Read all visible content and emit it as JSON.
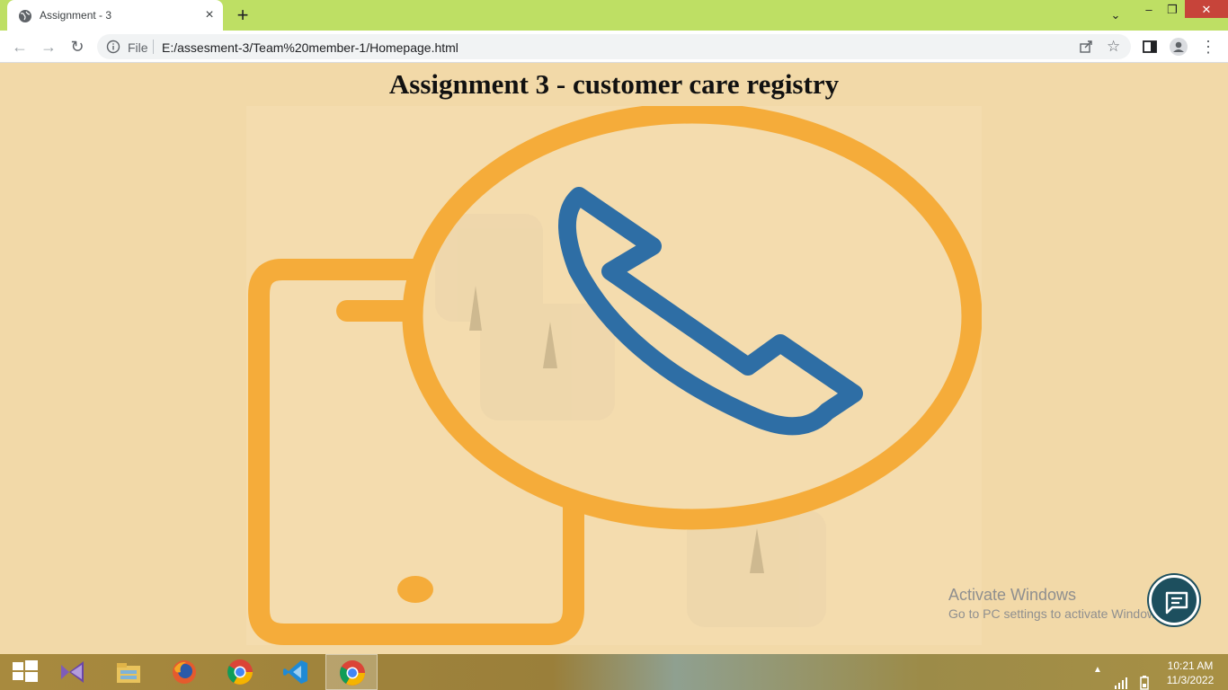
{
  "browser": {
    "tab": {
      "title": "Assignment - 3",
      "close": "×"
    },
    "new_tab": "+",
    "controls": {
      "tab_search": "⌄",
      "minimize": "–",
      "maximize": "❐",
      "close": "✕"
    },
    "nav": {
      "back": "←",
      "forward": "→",
      "reload": "↻"
    },
    "address": {
      "scheme": "File",
      "url": "E:/assesment-3/Team%20member-1/Homepage.html"
    },
    "menu": "⋮"
  },
  "page": {
    "title": "Assignment 3 - customer care registry",
    "hero_image": "phone-call-icon",
    "watermark": {
      "line1": "Activate Windows",
      "line2": "Go to PC settings to activate Windows."
    },
    "chat_button": "chat-icon"
  },
  "taskbar": {
    "apps": [
      "windows-start",
      "visual-studio",
      "file-explorer",
      "firefox",
      "chrome",
      "vscode",
      "chrome"
    ],
    "clock": {
      "time": "10:21 AM",
      "date": "11/3/2022"
    }
  },
  "colors": {
    "tabstrip": "#bedf64",
    "page_bg": "#f2d9a8",
    "phone_orange": "#f5ac3a",
    "handset_blue": "#2e6ea5",
    "chat_fab": "#1d4f5e"
  }
}
